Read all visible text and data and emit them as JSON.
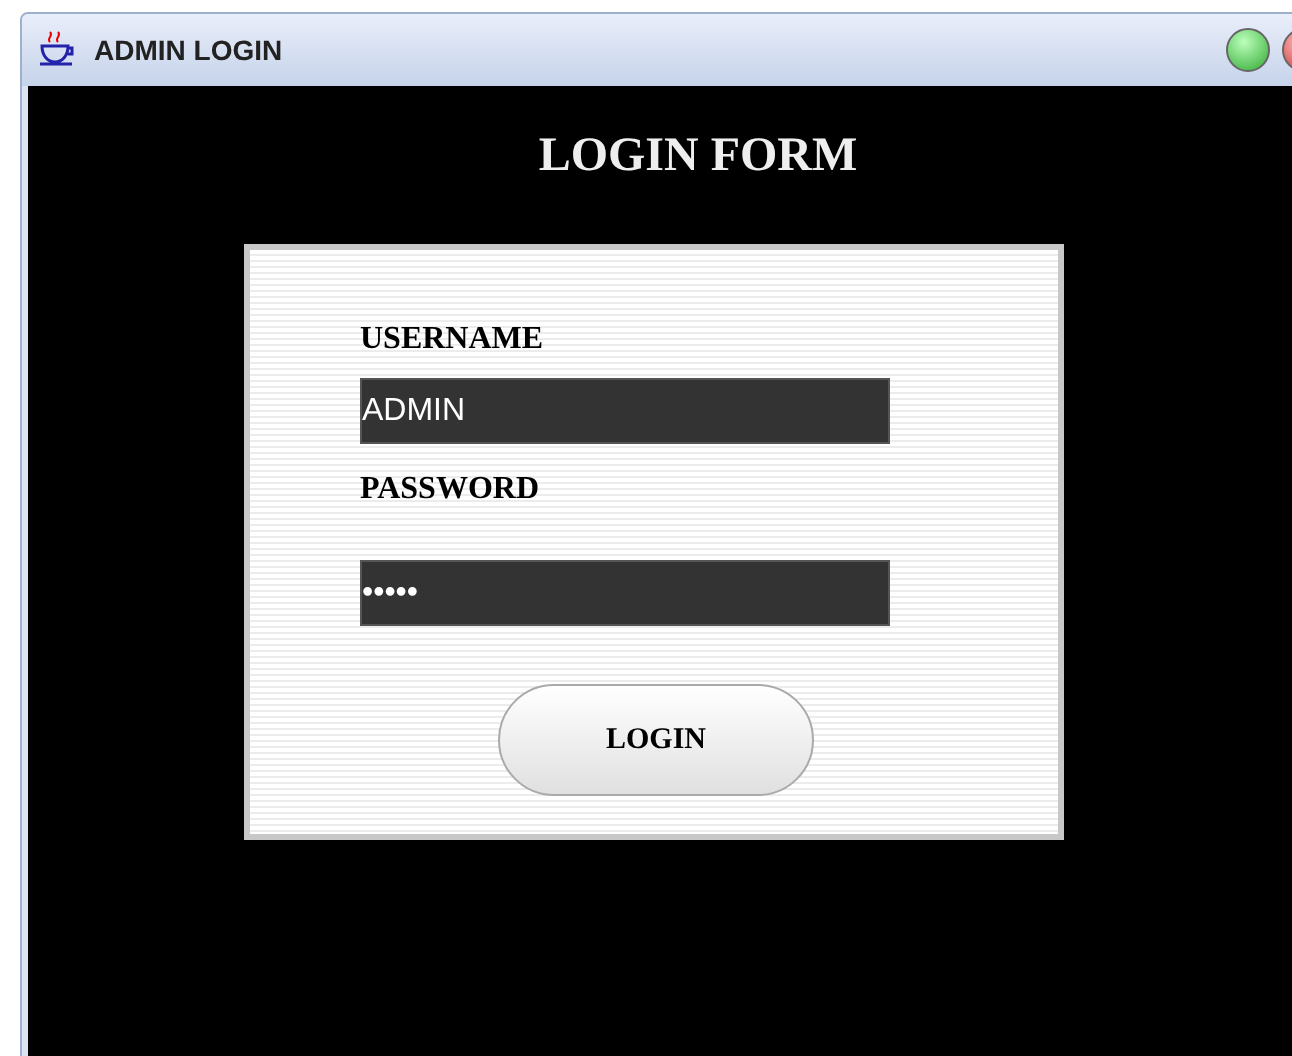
{
  "window": {
    "title": "ADMIN LOGIN"
  },
  "heading": "LOGIN FORM",
  "fields": [
    {
      "label": "USERNAME",
      "value": "ADMIN"
    },
    {
      "label": "PASSWORD",
      "value": "•••••"
    }
  ],
  "button": "LOGIN"
}
